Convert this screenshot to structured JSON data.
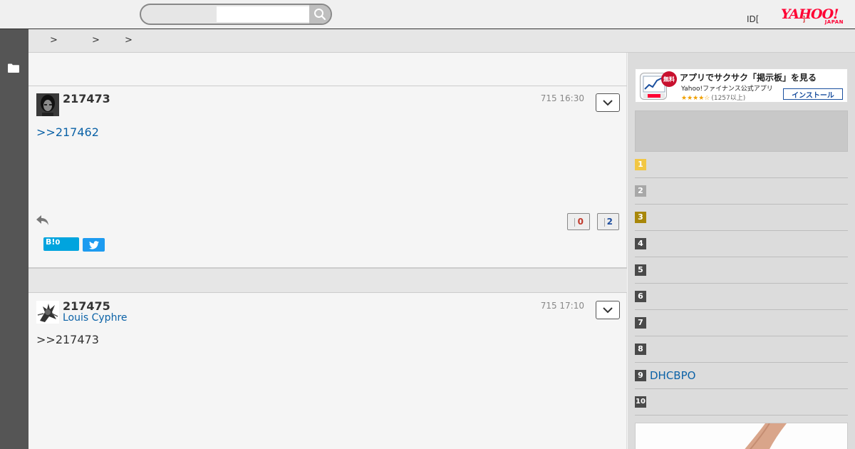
{
  "header": {
    "search": {
      "placeholder": ""
    },
    "id_link": "ID[",
    "id_suffix": "]",
    "logo": {
      "main": "YAHOO!",
      "sub": "JAPAN"
    }
  },
  "breadcrumb": {
    "separators": [
      ">",
      ">",
      ">"
    ]
  },
  "posts": [
    {
      "number": "217473",
      "user": "",
      "time": "715 16:30",
      "body": ">>217462",
      "votes_up": "0",
      "votes_down": "2",
      "hatena_label": "B!",
      "hatena_count": "0"
    },
    {
      "number": "217475",
      "user": "Louis Cyphre",
      "time": "715 17:10",
      "body": ">>217473"
    }
  ],
  "app_banner": {
    "badge": "無料",
    "title": "アプリでサクサク「掲示板」を見る",
    "subtitle": "Yahoo!ファイナンス公式アプリ",
    "stars": "★★★★☆",
    "review_count": "(1257以上)",
    "install_label": "インストール"
  },
  "ranking": [
    {
      "rank": "1",
      "color": "#f2c744",
      "text": ""
    },
    {
      "rank": "2",
      "color": "#a8a8a8",
      "text": ""
    },
    {
      "rank": "3",
      "color": "#a8870a",
      "text": ""
    },
    {
      "rank": "4",
      "color": "#4a4a4a",
      "text": ""
    },
    {
      "rank": "5",
      "color": "#4a4a4a",
      "text": ""
    },
    {
      "rank": "6",
      "color": "#4a4a4a",
      "text": ""
    },
    {
      "rank": "7",
      "color": "#4a4a4a",
      "text": ""
    },
    {
      "rank": "8",
      "color": "#4a4a4a",
      "text": ""
    },
    {
      "rank": "9",
      "color": "#4a4a4a",
      "text": "DHCBPO"
    },
    {
      "rank": "10",
      "color": "#4a4a4a",
      "text": ""
    }
  ]
}
